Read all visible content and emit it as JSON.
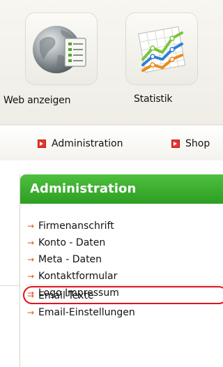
{
  "toolbar": {
    "items": [
      {
        "label": "Web anzeigen",
        "icon": "globe-document-icon"
      },
      {
        "label": "Statistik",
        "icon": "line-chart-icon"
      }
    ]
  },
  "tabs": [
    {
      "label": "Administration",
      "icon": "red-arrow-icon"
    },
    {
      "label": "Shop",
      "icon": "red-arrow-icon"
    }
  ],
  "panel": {
    "title": "Administration",
    "items": [
      {
        "label": "Firmenanschrift"
      },
      {
        "label": "Konto - Daten"
      },
      {
        "label": "Meta - Daten"
      },
      {
        "label": "Kontaktformular"
      },
      {
        "label": "Logo Impressum"
      }
    ],
    "items2": [
      {
        "label": "Email-Texte",
        "highlighted": true
      },
      {
        "label": "Email-Einstellungen"
      }
    ]
  },
  "colors": {
    "panel_header": "#37a82b",
    "arrow": "#e3521c",
    "highlight": "#e0141a",
    "tab_icon": "#e8342a"
  }
}
